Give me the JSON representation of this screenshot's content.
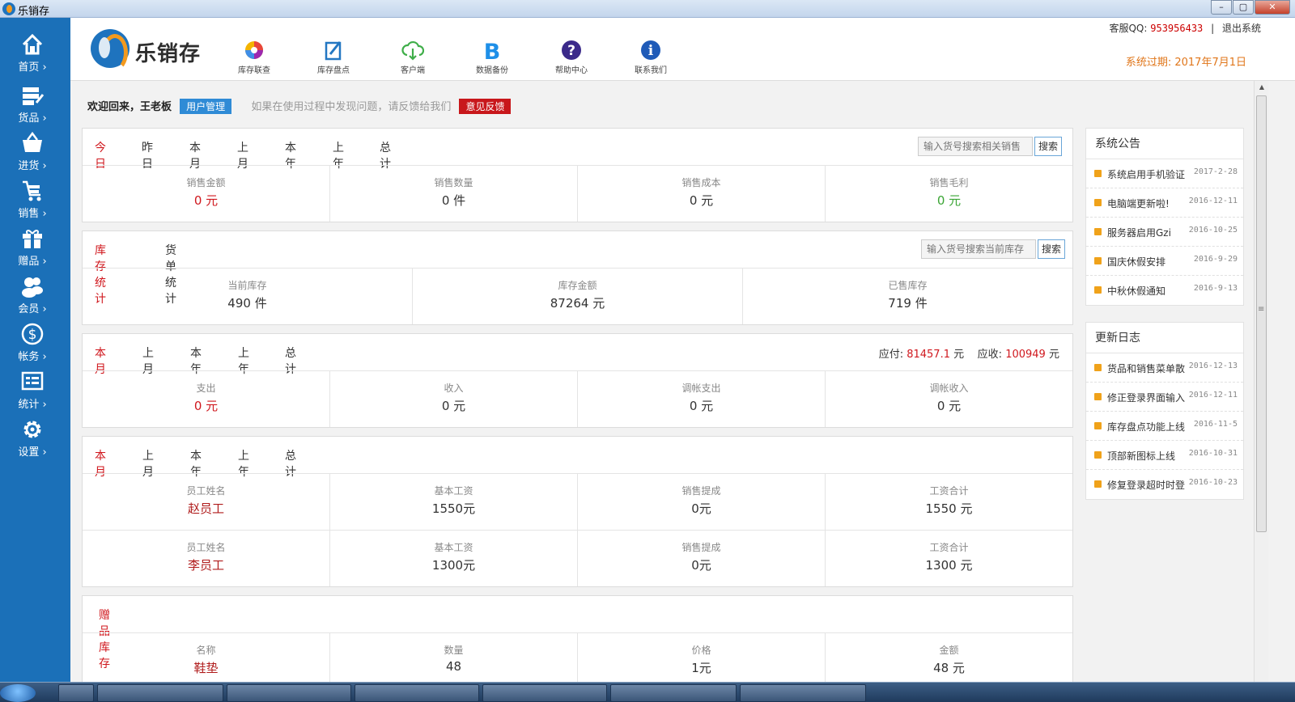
{
  "window": {
    "title": "乐销存",
    "min": "–",
    "max": "▢",
    "close": "✕"
  },
  "sidebar": {
    "items": [
      {
        "label": "首页",
        "icon": "home-icon"
      },
      {
        "label": "货品",
        "icon": "goods-icon"
      },
      {
        "label": "进货",
        "icon": "basket-icon"
      },
      {
        "label": "销售",
        "icon": "cart-icon"
      },
      {
        "label": "赠品",
        "icon": "gift-icon"
      },
      {
        "label": "会员",
        "icon": "members-icon"
      },
      {
        "label": "帐务",
        "icon": "dollar-icon"
      },
      {
        "label": "统计",
        "icon": "stats-icon"
      },
      {
        "label": "设置",
        "icon": "gear-icon"
      }
    ]
  },
  "header": {
    "logo_text": "乐销存",
    "nav": [
      {
        "label": "库存联查",
        "icon": "color-wheel-icon"
      },
      {
        "label": "库存盘点",
        "icon": "edit-note-icon"
      },
      {
        "label": "客户端",
        "icon": "cloud-download-icon"
      },
      {
        "label": "数据备份",
        "icon": "backup-b-icon"
      },
      {
        "label": "帮助中心",
        "icon": "help-icon"
      },
      {
        "label": "联系我们",
        "icon": "info-icon"
      }
    ],
    "service_label": "客服QQ:",
    "service_qq": "953956433",
    "separator": "|",
    "logout": "退出系统",
    "expire": "系统过期: 2017年7月1日"
  },
  "welcome": {
    "text": "欢迎回来，王老板",
    "user_mgmt": "用户管理",
    "hint": "如果在使用过程中发现问题，请反馈给我们",
    "feedback": "意见反馈"
  },
  "sales": {
    "tabs": [
      "今日",
      "昨日",
      "本月",
      "上月",
      "本年",
      "上年",
      "总计"
    ],
    "search_placeholder": "输入货号搜索相关销售",
    "search_btn": "搜索",
    "cells": [
      {
        "label": "销售金额",
        "value": "0 元"
      },
      {
        "label": "销售数量",
        "value": "0 件"
      },
      {
        "label": "销售成本",
        "value": "0 元"
      },
      {
        "label": "销售毛利",
        "value": "0 元"
      }
    ]
  },
  "stock": {
    "tabs": [
      "库存统计",
      "货单统计"
    ],
    "search_placeholder": "输入货号搜索当前库存",
    "search_btn": "搜索",
    "cells": [
      {
        "label": "当前库存",
        "value": "490 件"
      },
      {
        "label": "库存金额",
        "value": "87264 元"
      },
      {
        "label": "已售库存",
        "value": "719 件"
      }
    ]
  },
  "finance": {
    "tabs": [
      "本月",
      "上月",
      "本年",
      "上年",
      "总计"
    ],
    "payable_label": "应付:",
    "payable": "81457.1",
    "receivable_label": "应收:",
    "receivable": "100949",
    "unit": "元",
    "cells": [
      {
        "label": "支出",
        "value": "0 元"
      },
      {
        "label": "收入",
        "value": "0 元"
      },
      {
        "label": "调帐支出",
        "value": "0 元"
      },
      {
        "label": "调帐收入",
        "value": "0 元"
      }
    ]
  },
  "salary": {
    "tabs": [
      "本月",
      "上月",
      "本年",
      "上年",
      "总计"
    ],
    "rows": [
      [
        {
          "label": "员工姓名",
          "value": "赵员工"
        },
        {
          "label": "基本工资",
          "value": "1550元"
        },
        {
          "label": "销售提成",
          "value": "0元"
        },
        {
          "label": "工资合计",
          "value": "1550 元"
        }
      ],
      [
        {
          "label": "员工姓名",
          "value": "李员工"
        },
        {
          "label": "基本工资",
          "value": "1300元"
        },
        {
          "label": "销售提成",
          "value": "0元"
        },
        {
          "label": "工资合计",
          "value": "1300 元"
        }
      ]
    ]
  },
  "gifts": {
    "title": "赠品库存",
    "cells": [
      {
        "label": "名称",
        "value": "鞋垫"
      },
      {
        "label": "数量",
        "value": "48"
      },
      {
        "label": "价格",
        "value": "1元"
      },
      {
        "label": "金额",
        "value": "48 元"
      }
    ]
  },
  "notices": {
    "title": "系统公告",
    "items": [
      {
        "text": "系统启用手机验证",
        "date": "2017-2-28"
      },
      {
        "text": "电脑端更新啦!",
        "date": "2016-12-11"
      },
      {
        "text": "服务器启用Gzi",
        "date": "2016-10-25"
      },
      {
        "text": "国庆休假安排",
        "date": "2016-9-29"
      },
      {
        "text": "中秋休假通知",
        "date": "2016-9-13"
      }
    ]
  },
  "changelog": {
    "title": "更新日志",
    "items": [
      {
        "text": "货品和销售菜单散",
        "date": "2016-12-13"
      },
      {
        "text": "修正登录界面输入",
        "date": "2016-12-11"
      },
      {
        "text": "库存盘点功能上线",
        "date": "2016-11-5"
      },
      {
        "text": "顶部新图标上线",
        "date": "2016-10-31"
      },
      {
        "text": "修复登录超时时登",
        "date": "2016-10-23"
      }
    ]
  },
  "colors": {
    "sidebar": "#1b70b8",
    "accent_red": "#d0181e",
    "profit_green": "#3aa534",
    "bullet": "#f0a21a"
  }
}
